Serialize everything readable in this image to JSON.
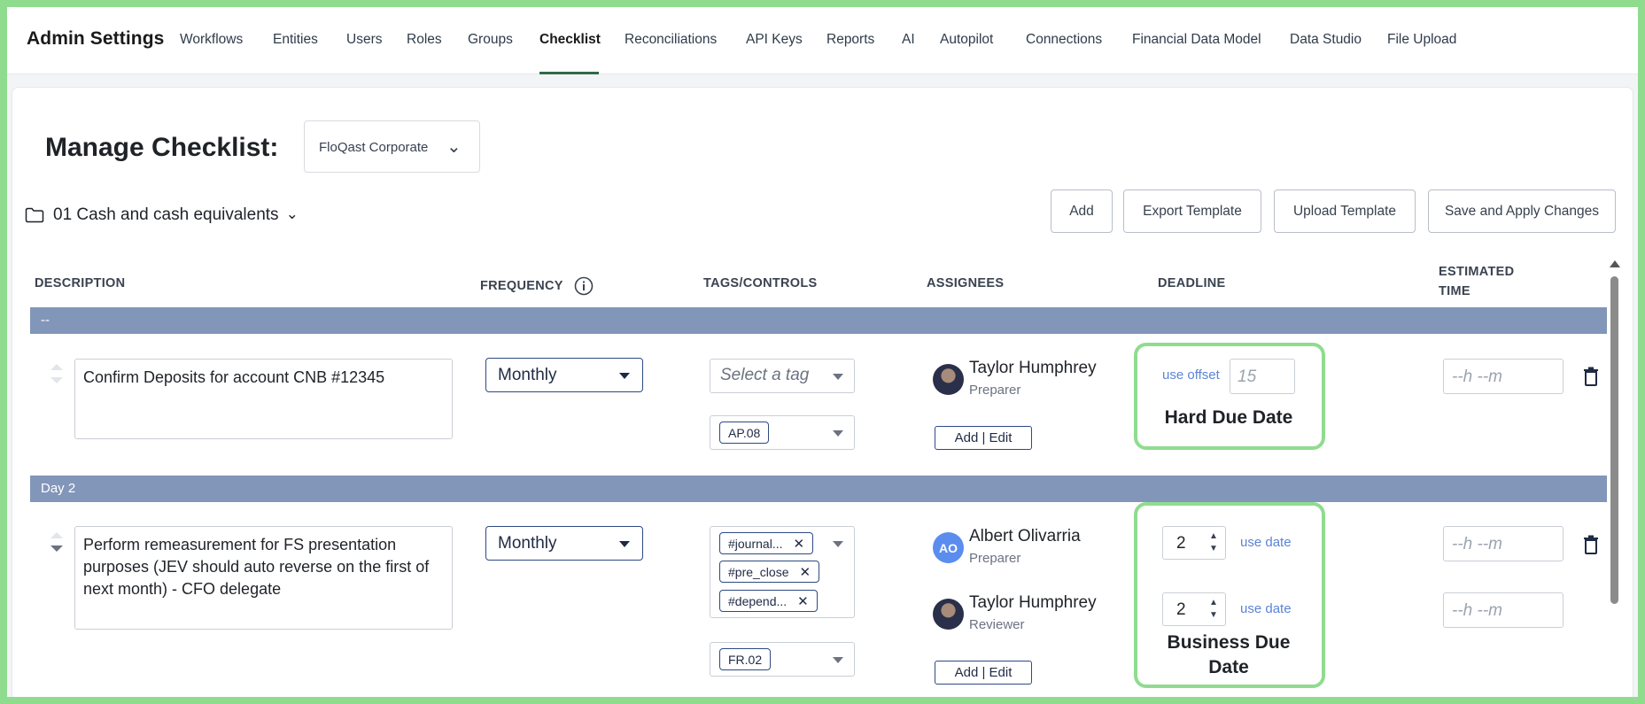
{
  "nav": {
    "brand": "Admin Settings",
    "tabs": [
      {
        "label": "Workflows"
      },
      {
        "label": "Entities"
      },
      {
        "label": "Users"
      },
      {
        "label": "Roles"
      },
      {
        "label": "Groups"
      },
      {
        "label": "Checklist"
      },
      {
        "label": "Reconciliations"
      },
      {
        "label": "API Keys"
      },
      {
        "label": "Reports"
      },
      {
        "label": "AI"
      },
      {
        "label": "Autopilot"
      },
      {
        "label": "Connections"
      },
      {
        "label": "Financial Data Model"
      },
      {
        "label": "Data Studio"
      },
      {
        "label": "File Upload"
      }
    ],
    "active_tab": "Checklist"
  },
  "page": {
    "title": "Manage Checklist:",
    "entity": "FloQast Corporate",
    "folder": "01 Cash and cash equivalents"
  },
  "toolbar": {
    "add": "Add",
    "export": "Export Template",
    "upload": "Upload Template",
    "save": "Save and Apply Changes"
  },
  "columns": {
    "description": "DESCRIPTION",
    "frequency": "FREQUENCY",
    "tags": "TAGS/CONTROLS",
    "assignees": "ASSIGNEES",
    "deadline": "DEADLINE",
    "estimated_line1": "ESTIMATED",
    "estimated_line2": "TIME"
  },
  "groups": [
    {
      "label": "--",
      "row": {
        "description": "Confirm Deposits for account CNB #12345",
        "frequency": "Monthly",
        "tag_placeholder": "Select a tag",
        "control": "AP.08",
        "assignees": [
          {
            "name": "Taylor Humphrey",
            "role": "Preparer"
          }
        ],
        "add_edit": "Add | Edit",
        "deadline": {
          "link": "use offset",
          "offset_placeholder": "15",
          "label": "Hard Due Date"
        },
        "estimated_placeholder": "--h --m"
      }
    },
    {
      "label": "Day 2",
      "row": {
        "description": "Perform remeasurement for FS presentation purposes (JEV should auto reverse on the first of next month) - CFO delegate",
        "frequency": "Monthly",
        "tags": [
          "#journal...",
          "#pre_close",
          "#depend..."
        ],
        "control": "FR.02",
        "assignees": [
          {
            "name": "Albert Olivarria",
            "role": "Preparer",
            "initials": "AO"
          },
          {
            "name": "Taylor Humphrey",
            "role": "Reviewer"
          }
        ],
        "add_edit": "Add | Edit",
        "deadline": {
          "preparer_day": "2",
          "reviewer_day": "2",
          "link": "use date",
          "label": "Business Due Date"
        },
        "estimated_placeholder": "--h --m"
      }
    }
  ],
  "colors": {
    "accent_green": "#8fdc8f",
    "group_bar": "#8296b9",
    "primary_blue": "#2d4a82",
    "link_blue": "#5b84d6"
  }
}
